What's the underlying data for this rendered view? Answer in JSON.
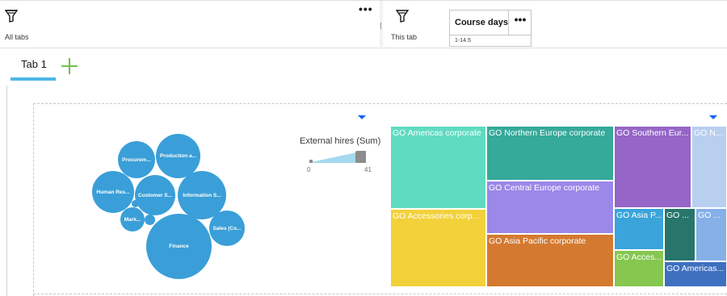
{
  "filters": {
    "all_tabs_label": "All tabs",
    "this_tab_label": "This tab",
    "more_label": "•••",
    "chip": {
      "title": "Course days",
      "menu": "•••",
      "value": "1-14.5"
    }
  },
  "tabs": {
    "items": [
      {
        "label": "Tab 1",
        "active": true
      }
    ],
    "add_icon": "plus-icon"
  },
  "bubble_chart": {
    "bubbles": [
      {
        "label": "Procurem..."
      },
      {
        "label": "Production a..."
      },
      {
        "label": "Human Res..."
      },
      {
        "label": "Customer S..."
      },
      {
        "label": "Information S..."
      },
      {
        "label": "Mark..."
      },
      {
        "label": "Sales (Co..."
      },
      {
        "label": "Finance"
      }
    ],
    "color": "#3a9fd8"
  },
  "slider": {
    "title": "External hires (Sum)",
    "min_label": "0",
    "max_label": "41"
  },
  "treemap": {
    "tiles": [
      {
        "label": "GO Americas corporate",
        "color": "#5fdbc2"
      },
      {
        "label": "GO Accessories corp...",
        "color": "#f2d13a"
      },
      {
        "label": "GO Northern Europe corporate",
        "color": "#35a99a"
      },
      {
        "label": "GO Central Europe corporate",
        "color": "#9b88e8"
      },
      {
        "label": "GO Asia Pacific corporate",
        "color": "#d47a30"
      },
      {
        "label": "GO Southern Eur...",
        "color": "#9565c7"
      },
      {
        "label": "GO N...",
        "color": "#b9cff0"
      },
      {
        "label": "GO Asia P...",
        "color": "#3ba4da"
      },
      {
        "label": "GO ...",
        "color": "#27756b"
      },
      {
        "label": "GO ...",
        "color": "#85b0e8"
      },
      {
        "label": "GO Acces...",
        "color": "#86c750"
      },
      {
        "label": "GO Americas...",
        "color": "#3e70c0"
      }
    ]
  }
}
